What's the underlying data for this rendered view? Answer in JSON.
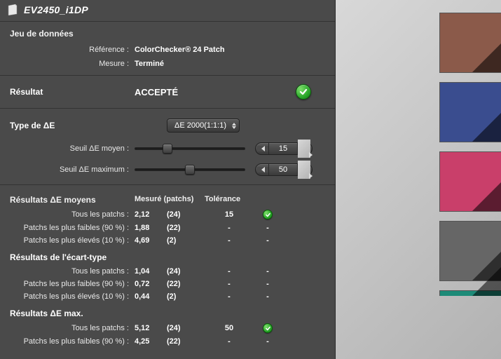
{
  "titlebar": {
    "title": "EV2450_i1DP"
  },
  "dataset": {
    "heading": "Jeu de données",
    "reference_label": "Référence :",
    "reference_value": "ColorChecker® 24 Patch",
    "measure_label": "Mesure :",
    "measure_value": "Terminé"
  },
  "result": {
    "label": "Résultat",
    "value": "ACCEPTÉ"
  },
  "deltae_type": {
    "label": "Type de ΔE",
    "selected": "ΔE 2000(1:1:1)"
  },
  "sliders": {
    "avg": {
      "label": "Seuil ΔE moyen :",
      "value": "15",
      "percent": 30
    },
    "max": {
      "label": "Seuil ΔE maximum :",
      "value": "50",
      "percent": 50
    }
  },
  "table": {
    "col_measured": "Mesuré (patchs)",
    "col_tolerance": "Tolérance",
    "groups": [
      {
        "title": "Résultats ΔE moyens",
        "has_cols": true,
        "rows": [
          {
            "label": "Tous les patchs :",
            "measured": "2,12",
            "count": "(24)",
            "tolerance": "15",
            "pass": true
          },
          {
            "label": "Patchs les plus faibles (90 %) :",
            "measured": "1,88",
            "count": "(22)",
            "tolerance": "-",
            "pass": "-"
          },
          {
            "label": "Patchs les plus élevés (10 %) :",
            "measured": "4,69",
            "count": "(2)",
            "tolerance": "-",
            "pass": "-"
          }
        ]
      },
      {
        "title": "Résultats de l'écart-type",
        "has_cols": false,
        "rows": [
          {
            "label": "Tous les patchs :",
            "measured": "1,04",
            "count": "(24)",
            "tolerance": "-",
            "pass": "-"
          },
          {
            "label": "Patchs les plus faibles (90 %) :",
            "measured": "0,72",
            "count": "(22)",
            "tolerance": "-",
            "pass": "-"
          },
          {
            "label": "Patchs les plus élevés (10 %) :",
            "measured": "0,44",
            "count": "(2)",
            "tolerance": "-",
            "pass": "-"
          }
        ]
      },
      {
        "title": "Résultats ΔE max.",
        "has_cols": false,
        "rows": [
          {
            "label": "Tous les patchs :",
            "measured": "5,12",
            "count": "(24)",
            "tolerance": "50",
            "pass": true
          },
          {
            "label": "Patchs les plus faibles (90 %) :",
            "measured": "4,25",
            "count": "(22)",
            "tolerance": "-",
            "pass": "-"
          }
        ]
      }
    ]
  },
  "swatches": {
    "items": [
      {
        "name": "swatch-brown",
        "class": "sw-brown"
      },
      {
        "name": "swatch-blue",
        "class": "sw-blue"
      },
      {
        "name": "swatch-pink",
        "class": "sw-pink"
      },
      {
        "name": "swatch-grey",
        "class": "sw-grey"
      },
      {
        "name": "swatch-teal",
        "class": "sw-teal"
      }
    ]
  }
}
